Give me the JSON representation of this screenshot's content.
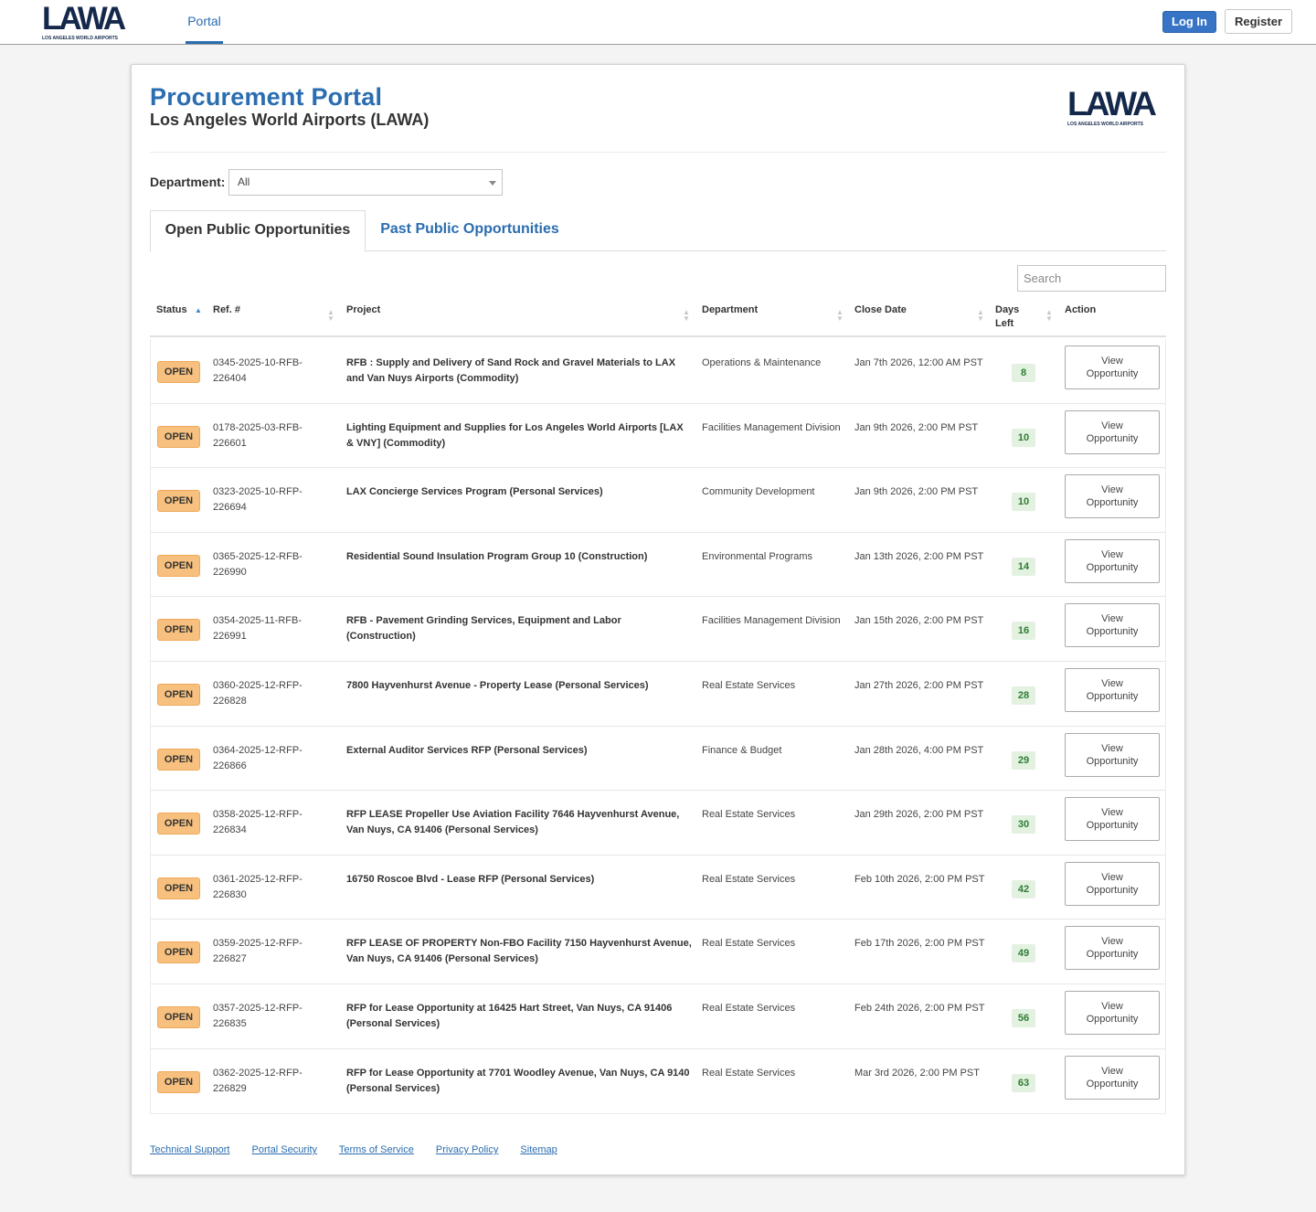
{
  "topbar": {
    "logo_text": "LAWA",
    "logo_subtext": "LOS ANGELES WORLD AIRPORTS",
    "nav_portal": "Portal",
    "login_label": "Log In",
    "register_label": "Register"
  },
  "header": {
    "title": "Procurement Portal",
    "subtitle": "Los Angeles World Airports (LAWA)",
    "logo_text": "LAWA",
    "logo_subtext": "LOS ANGELES WORLD AIRPORTS"
  },
  "filter": {
    "department_label": "Department:",
    "department_value": "All"
  },
  "tabs": [
    {
      "label": "Open Public Opportunities",
      "active": true
    },
    {
      "label": "Past Public Opportunities",
      "active": false
    }
  ],
  "search": {
    "placeholder": "Search"
  },
  "table": {
    "columns": [
      "Status",
      "Ref. #",
      "Project",
      "Department",
      "Close Date",
      "Days Left",
      "Action"
    ],
    "rows": [
      {
        "status": "OPEN",
        "ref": "0345-2025-10-RFB-226404",
        "project": "RFB : Supply and Delivery of Sand Rock and Gravel Materials to LAX and Van Nuys Airports (Commodity)",
        "department": "Operations & Maintenance",
        "close_date": "Jan 7th 2026, 12:00 AM PST",
        "days_left": "8",
        "action": "View Opportunity"
      },
      {
        "status": "OPEN",
        "ref": "0178-2025-03-RFB-226601",
        "project": "Lighting Equipment and Supplies for Los Angeles World Airports [LAX & VNY] (Commodity)",
        "department": "Facilities Management Division",
        "close_date": "Jan 9th 2026, 2:00 PM PST",
        "days_left": "10",
        "action": "View Opportunity"
      },
      {
        "status": "OPEN",
        "ref": "0323-2025-10-RFP-226694",
        "project": "LAX Concierge Services Program (Personal Services)",
        "department": "Community Development",
        "close_date": "Jan 9th 2026, 2:00 PM PST",
        "days_left": "10",
        "action": "View Opportunity"
      },
      {
        "status": "OPEN",
        "ref": "0365-2025-12-RFB-226990",
        "project": "Residential Sound Insulation Program Group 10 (Construction)",
        "department": "Environmental Programs",
        "close_date": "Jan 13th 2026, 2:00 PM PST",
        "days_left": "14",
        "action": "View Opportunity"
      },
      {
        "status": "OPEN",
        "ref": "0354-2025-11-RFB-226991",
        "project": "RFB - Pavement Grinding Services, Equipment and Labor (Construction)",
        "department": "Facilities Management Division",
        "close_date": "Jan 15th 2026, 2:00 PM PST",
        "days_left": "16",
        "action": "View Opportunity"
      },
      {
        "status": "OPEN",
        "ref": "0360-2025-12-RFP-226828",
        "project": "7800 Hayvenhurst Avenue - Property Lease (Personal Services)",
        "department": "Real Estate Services",
        "close_date": "Jan 27th 2026, 2:00 PM PST",
        "days_left": "28",
        "action": "View Opportunity"
      },
      {
        "status": "OPEN",
        "ref": "0364-2025-12-RFP-226866",
        "project": "External Auditor Services RFP (Personal Services)",
        "department": "Finance & Budget",
        "close_date": "Jan 28th 2026, 4:00 PM PST",
        "days_left": "29",
        "action": "View Opportunity"
      },
      {
        "status": "OPEN",
        "ref": "0358-2025-12-RFP-226834",
        "project": "RFP LEASE Propeller Use Aviation Facility 7646 Hayvenhurst Avenue, Van Nuys, CA 91406 (Personal Services)",
        "department": "Real Estate Services",
        "close_date": "Jan 29th 2026, 2:00 PM PST",
        "days_left": "30",
        "action": "View Opportunity"
      },
      {
        "status": "OPEN",
        "ref": "0361-2025-12-RFP-226830",
        "project": "16750 Roscoe Blvd - Lease RFP (Personal Services)",
        "department": "Real Estate Services",
        "close_date": "Feb 10th 2026, 2:00 PM PST",
        "days_left": "42",
        "action": "View Opportunity"
      },
      {
        "status": "OPEN",
        "ref": "0359-2025-12-RFP-226827",
        "project": "RFP LEASE OF PROPERTY Non-FBO Facility 7150 Hayvenhurst Avenue, Van Nuys, CA 91406 (Personal Services)",
        "department": "Real Estate Services",
        "close_date": "Feb 17th 2026, 2:00 PM PST",
        "days_left": "49",
        "action": "View Opportunity"
      },
      {
        "status": "OPEN",
        "ref": "0357-2025-12-RFP-226835",
        "project": "RFP for Lease Opportunity at 16425 Hart Street, Van Nuys, CA 91406 (Personal Services)",
        "department": "Real Estate Services",
        "close_date": "Feb 24th 2026, 2:00 PM PST",
        "days_left": "56",
        "action": "View Opportunity"
      },
      {
        "status": "OPEN",
        "ref": "0362-2025-12-RFP-226829",
        "project": "RFP for Lease Opportunity at 7701 Woodley Avenue, Van Nuys, CA 9140 (Personal Services)",
        "department": "Real Estate Services",
        "close_date": "Mar 3rd 2026, 2:00 PM PST",
        "days_left": "63",
        "action": "View Opportunity"
      }
    ]
  },
  "footer": {
    "links": [
      "Technical Support",
      "Portal Security",
      "Terms of Service",
      "Privacy Policy",
      "Sitemap"
    ]
  },
  "colors": {
    "accent": "#2a6db0",
    "open_badge": "#f7c07e",
    "days_badge": "#e2f1e0"
  }
}
